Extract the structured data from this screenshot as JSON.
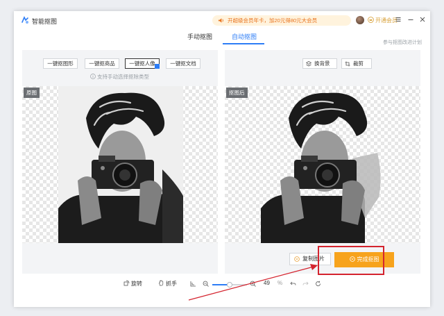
{
  "app": {
    "title": "智能抠图"
  },
  "header": {
    "banner": "开超级会员年卡，加20元得80元大会员",
    "vip_label": "开通会员"
  },
  "tabs": [
    {
      "label": "手动抠图"
    },
    {
      "label": "自动抠图"
    }
  ],
  "plan_link": "参与抠图改进计划",
  "left_panel": {
    "chips": [
      "一键抠图形",
      "一键抠商品",
      "一键抠人像",
      "一键抠文档"
    ],
    "active_chip": "一键抠人像",
    "hint": "支持手动选择抠除类型",
    "image_label": "原图"
  },
  "right_panel": {
    "tools": [
      "换背景",
      "裁剪"
    ],
    "image_label": "抠图后",
    "copy_button": "复制图片",
    "done_button": "完成抠图"
  },
  "bottom_bar": {
    "rotate": "旋转",
    "grab": "抓手",
    "zoom_value": "49",
    "zoom_unit": "%",
    "zoom_fraction": 0.49
  },
  "colors": {
    "accent": "#2d7df6",
    "done_button": "#f7a31c",
    "highlight": "#d4232e",
    "vip": "#d8a13a"
  }
}
